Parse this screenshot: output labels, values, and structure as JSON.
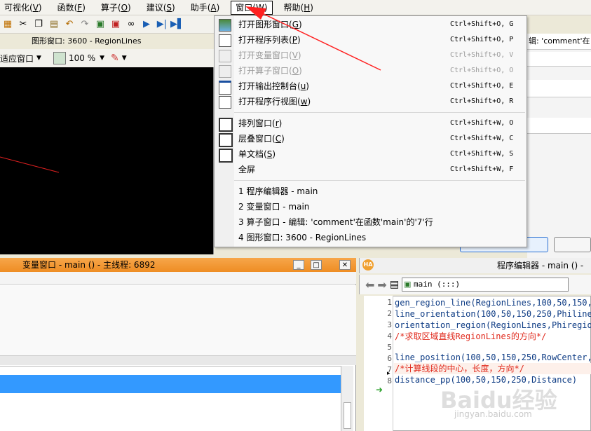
{
  "menubar": {
    "items": [
      {
        "label": "可视化(",
        "key": "V",
        "tail": ")"
      },
      {
        "label": "函数(",
        "key": "F",
        "tail": ")"
      },
      {
        "label": "算子(",
        "key": "O",
        "tail": ")"
      },
      {
        "label": "建议(",
        "key": "S",
        "tail": ")"
      },
      {
        "label": "助手(",
        "key": "A",
        "tail": ")"
      },
      {
        "label": "窗口(",
        "key": "W",
        "tail": ")"
      },
      {
        "label": "帮助(",
        "key": "H",
        "tail": ")"
      }
    ]
  },
  "graphics_window": {
    "title": "图形窗口: 3600 - RegionLines",
    "fit_label": "适应窗口",
    "zoom": "100 %"
  },
  "right_top": {
    "label": "辑: 'comment'在"
  },
  "window_menu": {
    "items": [
      {
        "label": "打开图形窗口(",
        "key": "G",
        "tail": ")",
        "shortcut": "Ctrl+Shift+O, G",
        "enabled": true,
        "icon": "graphics-window-icon"
      },
      {
        "label": "打开程序列表(",
        "key": "P",
        "tail": ")",
        "shortcut": "Ctrl+Shift+O, P",
        "enabled": true,
        "icon": "program-list-icon"
      },
      {
        "label": "打开变量窗口(",
        "key": "V",
        "tail": ")",
        "shortcut": "Ctrl+Shift+O, V",
        "enabled": false,
        "icon": "variable-window-icon"
      },
      {
        "label": "打开算子窗口(",
        "key": "O",
        "tail": ")",
        "shortcut": "Ctrl+Shift+O, O",
        "enabled": false,
        "icon": "operator-window-icon"
      },
      {
        "label": "打开输出控制台(",
        "key": "u",
        "tail": ")",
        "shortcut": "Ctrl+Shift+O, E",
        "enabled": true,
        "icon": "output-console-icon"
      },
      {
        "label": "打开程序行视图(",
        "key": "w",
        "tail": ")",
        "shortcut": "Ctrl+Shift+O, R",
        "enabled": true,
        "icon": "program-line-view-icon"
      },
      {
        "label": "排列窗口(",
        "key": "r",
        "tail": ")",
        "shortcut": "Ctrl+Shift+W, O",
        "enabled": true,
        "icon": "tile-windows-icon"
      },
      {
        "label": "层叠窗口(",
        "key": "C",
        "tail": ")",
        "shortcut": "Ctrl+Shift+W, C",
        "enabled": true,
        "icon": "cascade-windows-icon"
      },
      {
        "label": "单文档(",
        "key": "S",
        "tail": ")",
        "shortcut": "Ctrl+Shift+W, S",
        "enabled": true,
        "icon": "single-document-icon"
      },
      {
        "label": "全屏",
        "key": "",
        "tail": "",
        "shortcut": "Ctrl+Shift+W, F",
        "enabled": true,
        "icon": ""
      },
      {
        "label": "1 程序编辑器 - main",
        "key": "",
        "tail": "",
        "shortcut": "",
        "enabled": true,
        "icon": ""
      },
      {
        "label": "2 变量窗口 - main",
        "key": "",
        "tail": "",
        "shortcut": "",
        "enabled": true,
        "icon": ""
      },
      {
        "label": "3 算子窗口 - 编辑: 'comment'在函数'main'的'7'行",
        "key": "",
        "tail": "",
        "shortcut": "",
        "enabled": true,
        "icon": ""
      },
      {
        "label": "4 图形窗口: 3600 - RegionLines",
        "key": "",
        "tail": "",
        "shortcut": "",
        "enabled": true,
        "icon": ""
      }
    ]
  },
  "variable_window": {
    "title": "变量窗口 - main () - 主线程: 6892"
  },
  "program_editor": {
    "title": "程序编辑器 - main () -",
    "procedure": "main (:::)",
    "lines": [
      {
        "n": "1",
        "text": "gen_region_line(RegionLines,100,50,150,2",
        "comment": false
      },
      {
        "n": "2",
        "text": "line_orientation(100,50,150,250,Philine)",
        "comment": false
      },
      {
        "n": "3",
        "text": "orientation_region(RegionLines,Phiregion",
        "comment": false
      },
      {
        "n": "4",
        "text": "/*求取区域直线RegionLines的方向*/",
        "comment": true
      },
      {
        "n": "5",
        "text": "",
        "comment": false
      },
      {
        "n": "6",
        "text": "line_position(100,50,150,250,RowCenter,C",
        "comment": false
      },
      {
        "n": "7",
        "text": "/*计算线段的中心，长度，方向*/",
        "comment": true
      },
      {
        "n": "8",
        "text": "distance_pp(100,50,150,250,Distance)",
        "comment": false
      }
    ]
  },
  "watermark": "Baidu经验",
  "watermark_url": "jingyan.baidu.com"
}
